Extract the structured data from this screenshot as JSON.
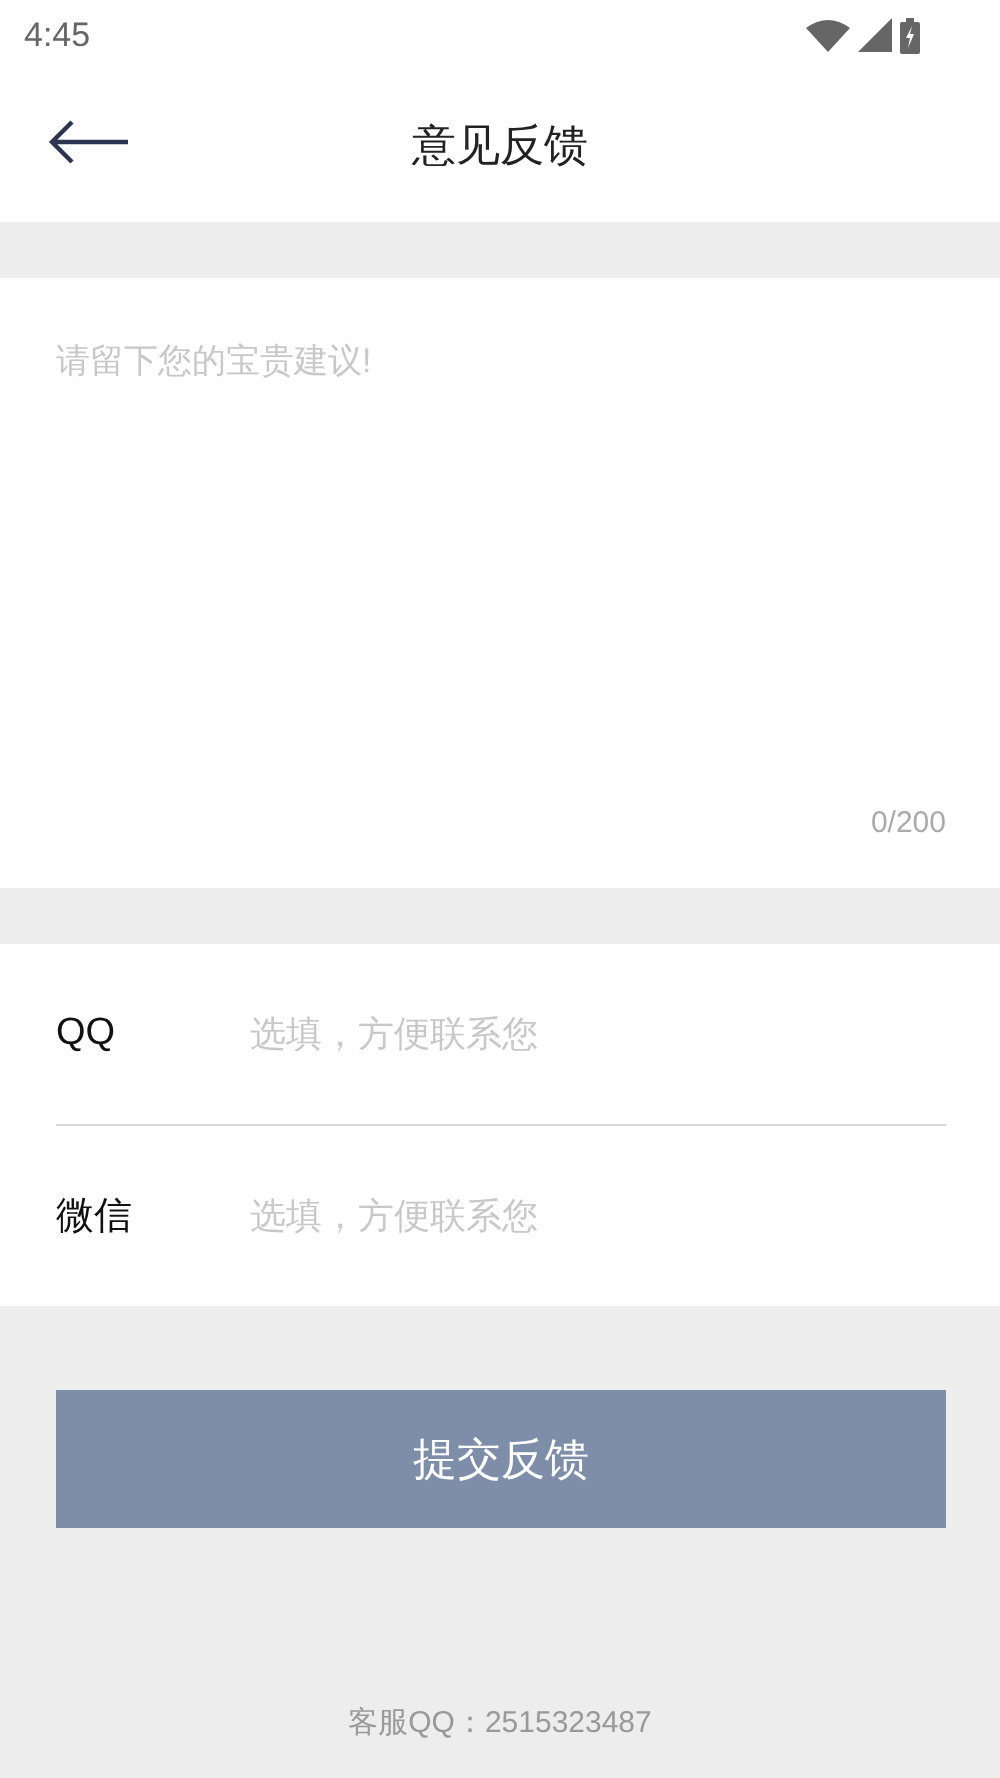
{
  "status_bar": {
    "time": "4:45"
  },
  "header": {
    "title": "意见反馈"
  },
  "feedback": {
    "placeholder": "请留下您的宝贵建议!",
    "counter": "0/200"
  },
  "contacts": [
    {
      "label": "QQ",
      "placeholder": "选填，方便联系您"
    },
    {
      "label": "微信",
      "placeholder": "选填，方便联系您"
    }
  ],
  "submit_button": "提交反馈",
  "footer": "客服QQ：2515323487"
}
